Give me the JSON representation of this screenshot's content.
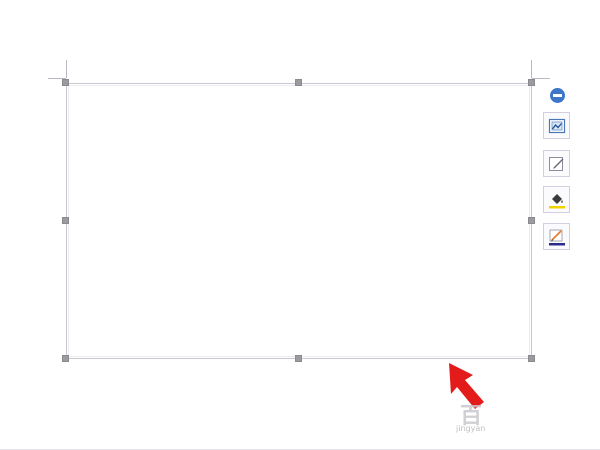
{
  "canvas": {
    "background": "#ffffff"
  },
  "shape": {
    "border_color": "#c8c8d0",
    "handle_color": "#9b9b9f",
    "handles": [
      "top-left",
      "top-middle",
      "top-right",
      "middle-left",
      "middle-right",
      "bottom-left",
      "bottom-middle",
      "bottom-right"
    ]
  },
  "side_toolbar": {
    "collapse_icon": "minus-circle-icon",
    "accent": "#3d76c8",
    "buttons": [
      {
        "name": "layout-options",
        "icon": "layout-picture-icon"
      },
      {
        "name": "shape-styles",
        "icon": "pen-edit-icon"
      },
      {
        "name": "fill-color",
        "icon": "paint-bucket-icon",
        "underline_color": "#f2d100"
      },
      {
        "name": "outline-color",
        "icon": "pencil-outline-icon",
        "underline_color": "#2b2b8c"
      }
    ]
  },
  "annotation": {
    "arrow_color": "#e31b1b",
    "icon": "red-arrow-icon"
  },
  "watermark": {
    "logo": "百",
    "text": "jingyan"
  }
}
